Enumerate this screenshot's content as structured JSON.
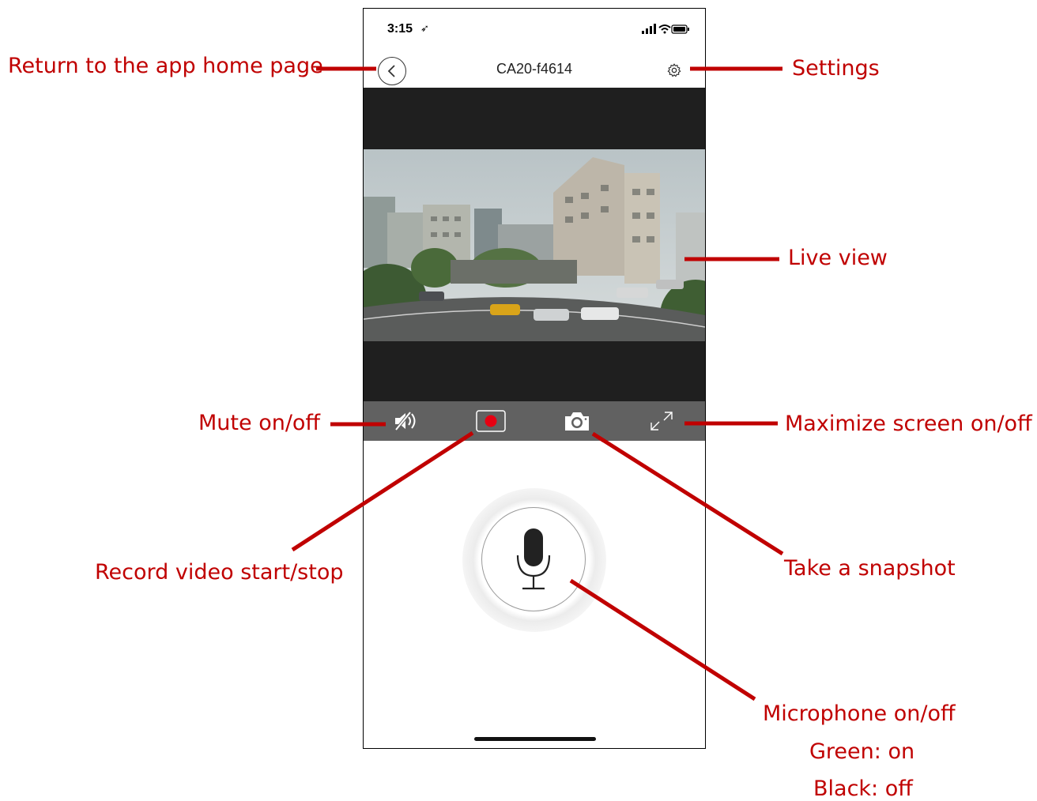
{
  "status_bar": {
    "time": "3:15",
    "location_icon": "location-arrow-icon",
    "signal_icon": "signal-bars-icon",
    "wifi_icon": "wifi-icon",
    "battery_icon": "battery-icon"
  },
  "header": {
    "title": "CA20-f4614",
    "back_icon": "chevron-left-icon",
    "settings_icon": "gear-icon"
  },
  "controls": {
    "mute_icon": "speaker-mute-icon",
    "record_icon": "record-icon",
    "snapshot_icon": "camera-icon",
    "maximize_icon": "expand-icon"
  },
  "talk": {
    "mic_icon": "microphone-icon"
  },
  "annotations": {
    "back": "Return to the app home page",
    "settings": "Settings",
    "live_view": "Live view",
    "mute": "Mute on/off",
    "maximize": "Maximize screen on/off",
    "record": "Record video start/stop",
    "snapshot": "Take a snapshot",
    "microphone": "Microphone on/off",
    "mic_green": "Green: on",
    "mic_black": "Black: off"
  },
  "colors": {
    "annotation": "#c00000",
    "video_bg": "#1f1f1f",
    "control_bar": "#616161",
    "record_red": "#e60012"
  }
}
